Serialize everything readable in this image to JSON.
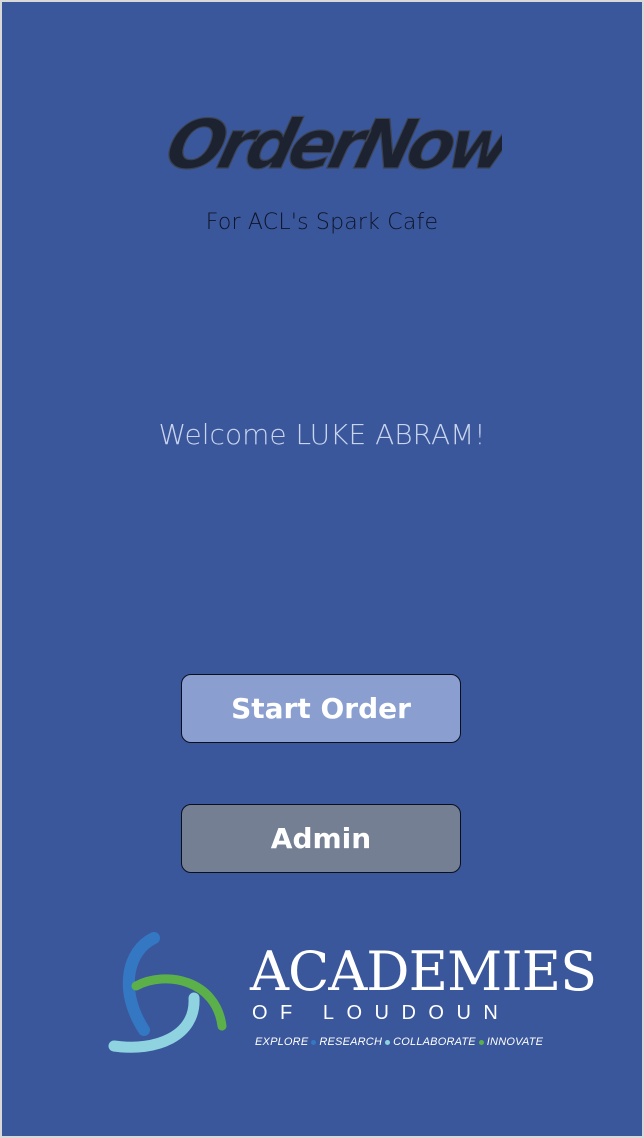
{
  "app": {
    "logo_text": "OrderNow",
    "subtitle": "For ACL's Spark Cafe"
  },
  "greeting": {
    "text": "Welcome LUKE ABRAM!"
  },
  "actions": {
    "start_order_label": "Start Order",
    "admin_label": "Admin"
  },
  "footer": {
    "org_name": "ACADEMIES",
    "org_sub": "OF LOUDOUN",
    "tagline": {
      "explore": "EXPLORE",
      "research": "RESEARCH",
      "collaborate": "COLLABORATE",
      "innovate": "INNOVATE"
    }
  },
  "colors": {
    "background": "#3a579b",
    "start_button": "#8a9fcf",
    "admin_button": "#747f93",
    "logo_text": "#2a3140",
    "emblem_blue": "#3478c4",
    "emblem_green": "#5cb04a",
    "emblem_cyan": "#8fd3e0"
  }
}
